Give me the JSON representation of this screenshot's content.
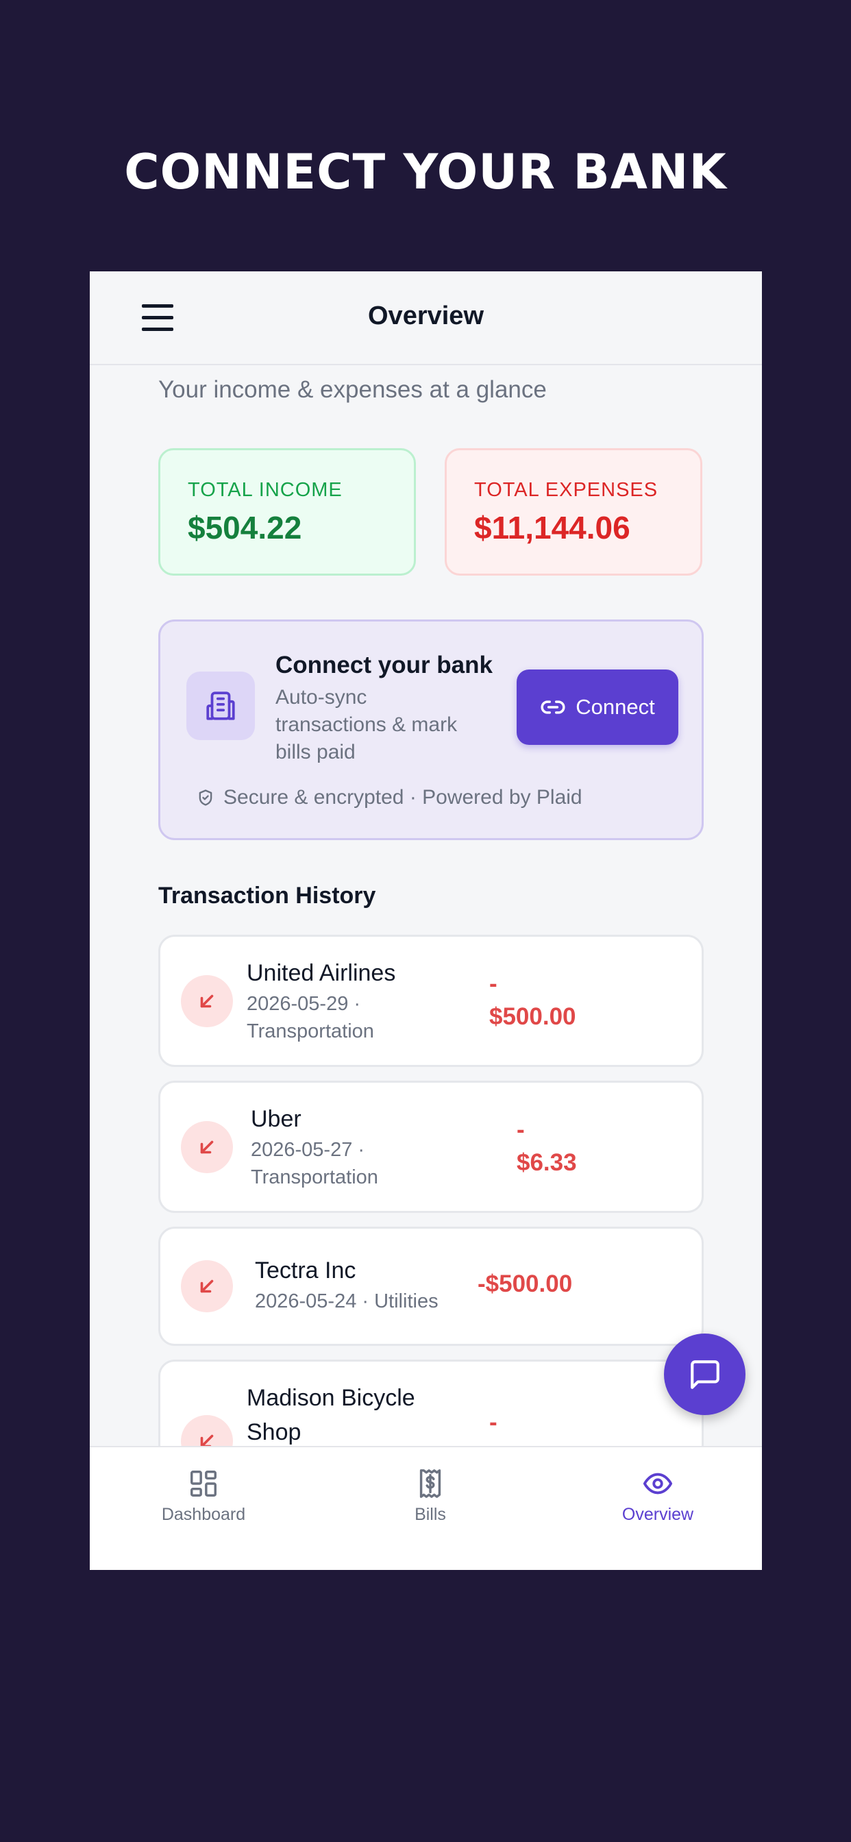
{
  "headline": "CONNECT YOUR BANK",
  "appbar": {
    "title": "Overview"
  },
  "subtitle": "Your income & expenses at a glance",
  "stats": {
    "income_label": "TOTAL INCOME",
    "income_value": "$504.22",
    "expense_label": "TOTAL EXPENSES",
    "expense_value": "$11,144.06"
  },
  "bank_card": {
    "title": "Connect your bank",
    "description": "Auto-sync transactions & mark bills paid",
    "button_label": "Connect",
    "secure_text": "Secure & encrypted · Powered by Plaid"
  },
  "transactions_title": "Transaction History",
  "transactions": [
    {
      "name": "United Airlines",
      "meta": "2026-05-29 · Transportation",
      "amount_sign": "-",
      "amount": "$500.00"
    },
    {
      "name": "Uber",
      "meta": "2026-05-27 · Transportation",
      "amount_sign": "-",
      "amount": "$6.33"
    },
    {
      "name": "Tectra Inc",
      "meta": "2026-05-24 · Utilities",
      "amount": "-$500.00"
    },
    {
      "name": "Madison Bicycle Shop",
      "amount_sign": "-"
    }
  ],
  "bottom_nav": [
    {
      "label": "Dashboard",
      "icon": "grid-icon"
    },
    {
      "label": "Bills",
      "icon": "receipt-icon"
    },
    {
      "label": "Overview",
      "icon": "eye-icon",
      "active": true
    }
  ],
  "colors": {
    "background": "#1f1838",
    "accent": "#5b3fd0",
    "income": "#15803d",
    "expense": "#dc2626"
  }
}
